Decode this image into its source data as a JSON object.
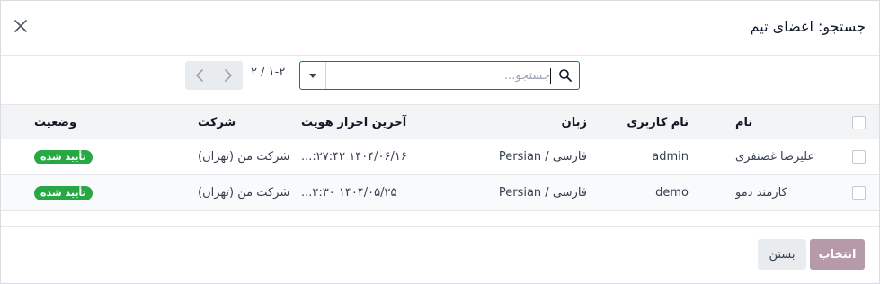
{
  "dialog": {
    "title": "جستجو: اعضای تیم",
    "close_icon": "close-icon"
  },
  "search": {
    "placeholder": "جستجو...",
    "value": "",
    "icon": "search-icon",
    "toggle_icon": "caret-down-icon"
  },
  "pager": {
    "value": "۱-۲ / ۲",
    "prev_icon": "chevron-left-icon",
    "next_icon": "chevron-right-icon"
  },
  "table": {
    "headers": {
      "name": "نام",
      "username": "نام کاربری",
      "language": "زبان",
      "last_login": "آخرین احراز هویت",
      "company": "شرکت",
      "status": "وضعیت"
    },
    "rows": [
      {
        "name": "علیرضا غضنفری",
        "username": "admin",
        "language": "Persian / فارسی",
        "last_login": "۱۴۰۴/۰۶/۱۶ ۲۷:۴۲:...",
        "company": "شرکت من (تهران)",
        "status": "تأیید شده"
      },
      {
        "name": "کارمند دمو",
        "username": "demo",
        "language": "Persian / فارسی",
        "last_login": "۱۴۰۴/۰۵/۲۵ ۲:۳۰...",
        "company": "شرکت من (تهران)",
        "status": "تأیید شده"
      }
    ]
  },
  "footer": {
    "select_label": "انتخاب",
    "close_label": "بستن"
  },
  "colors": {
    "accent": "#017e84",
    "badge": "#28a745",
    "primary_button": "#b79aaa"
  }
}
